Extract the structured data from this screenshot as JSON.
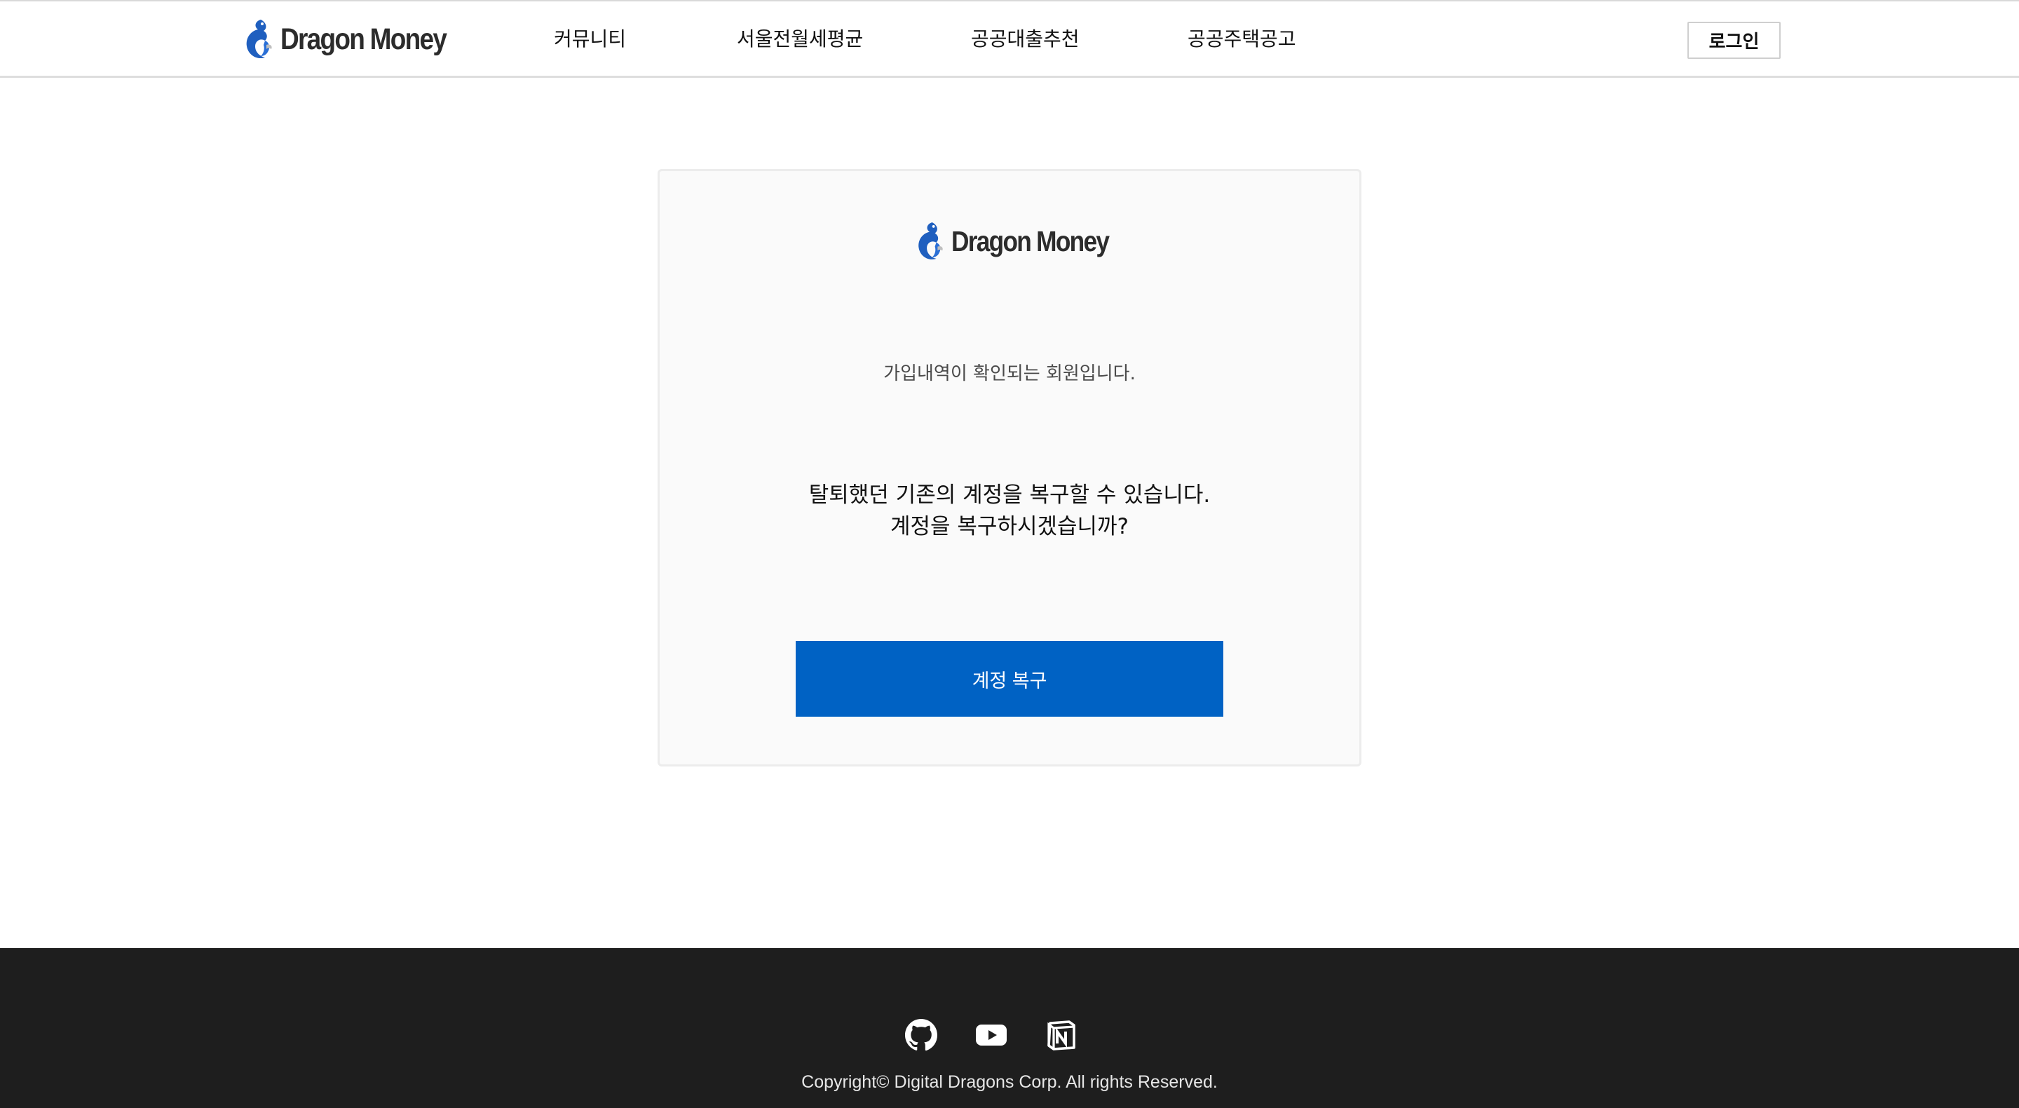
{
  "header": {
    "brand": "Dragon Money",
    "nav": [
      {
        "label": "커뮤니티"
      },
      {
        "label": "서울전월세평균"
      },
      {
        "label": "공공대출추천"
      },
      {
        "label": "공공주택공고"
      }
    ],
    "login_label": "로그인"
  },
  "card": {
    "brand": "Dragon Money",
    "info": "가입내역이 확인되는 회원입니다.",
    "question_line1": "탈퇴했던 기존의 계정을 복구할 수 있습니다.",
    "question_line2": "계정을 복구하시겠습니까?",
    "restore_label": "계정 복구"
  },
  "footer": {
    "icons": [
      "github-icon",
      "youtube-icon",
      "notion-icon"
    ],
    "copyright": "Copyright© Digital Dragons Corp. All rights Reserved."
  },
  "colors": {
    "primary": "#0062c4",
    "footer_bg": "#1e1e1e",
    "card_bg": "#fafafa"
  }
}
